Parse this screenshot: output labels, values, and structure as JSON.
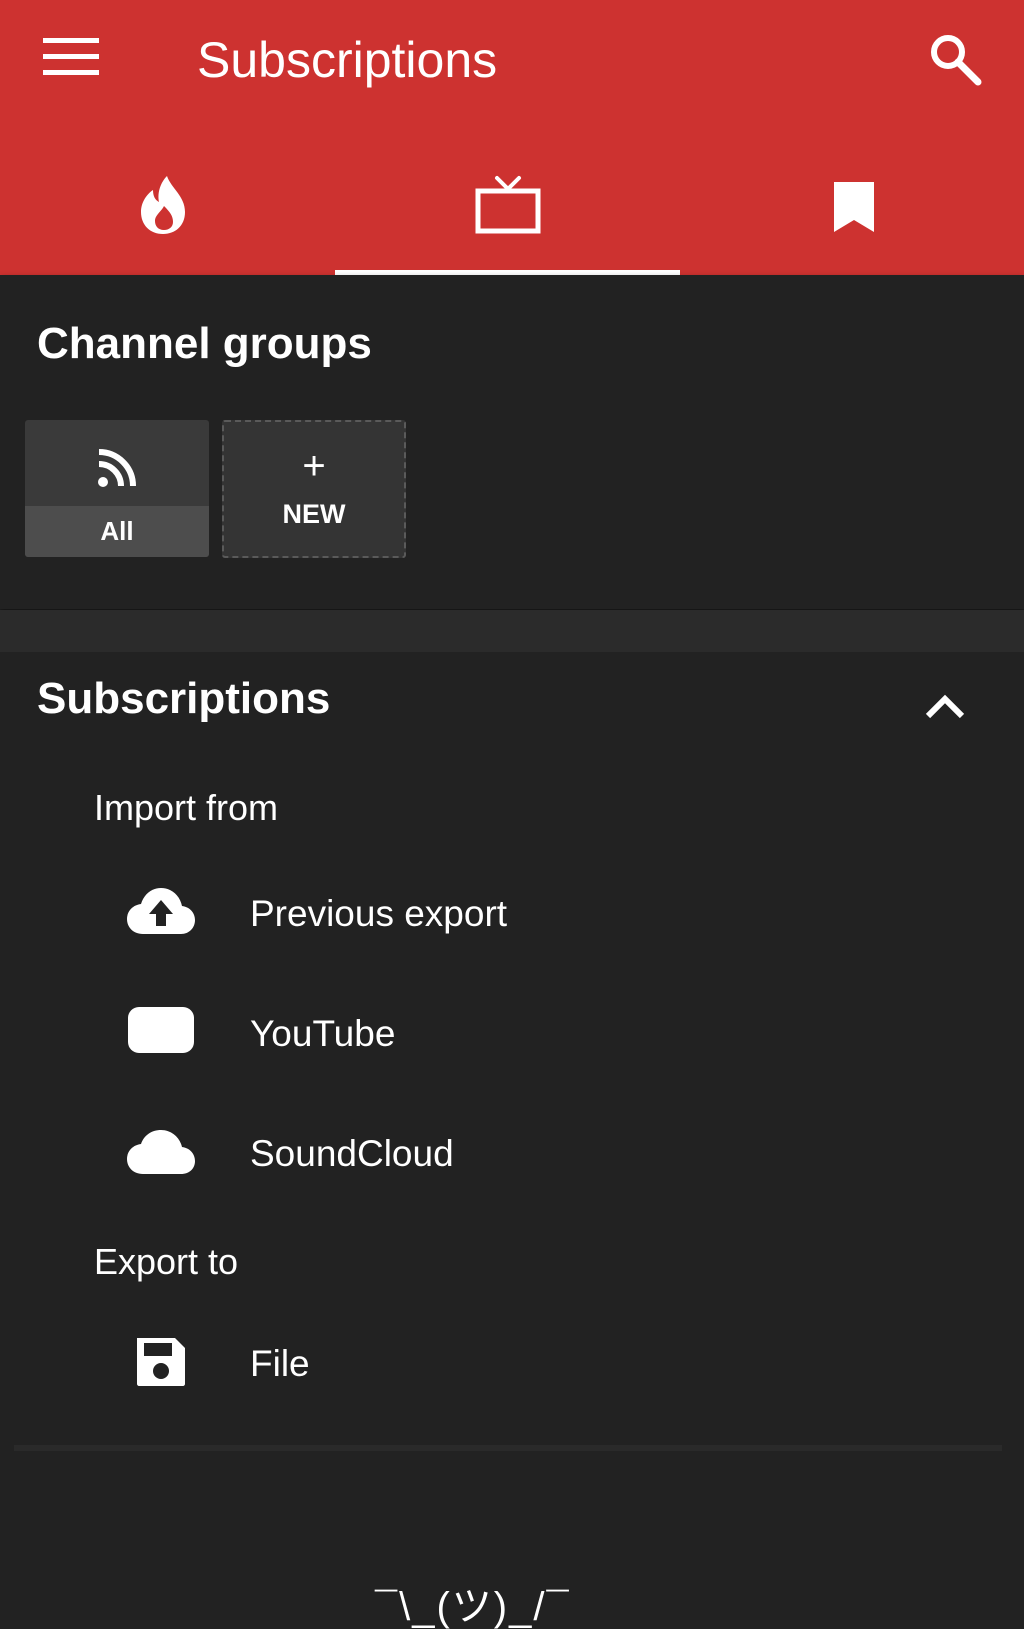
{
  "appbar": {
    "title": "Subscriptions",
    "color": "#cd3230",
    "menu_icon": "menu-icon",
    "search_icon": "search-icon"
  },
  "tabs": [
    {
      "name": "trending",
      "icon": "fire-icon",
      "selected": false
    },
    {
      "name": "subscriptions",
      "icon": "tv-icon",
      "selected": true
    },
    {
      "name": "bookmarks",
      "icon": "bookmark-icon",
      "selected": false
    }
  ],
  "channel_groups": {
    "title": "Channel groups",
    "groups": [
      {
        "label": "All",
        "icon": "rss-icon"
      }
    ],
    "new_button": {
      "symbol": "+",
      "label": "NEW"
    }
  },
  "subscriptions": {
    "title": "Subscriptions",
    "collapse_icon": "chevron-up-icon",
    "import_heading": "Import from",
    "import_items": [
      {
        "label": "Previous export",
        "icon": "cloud-upload-icon"
      },
      {
        "label": "YouTube",
        "icon": "youtube-icon"
      },
      {
        "label": "SoundCloud",
        "icon": "cloud-icon"
      }
    ],
    "export_heading": "Export to",
    "export_items": [
      {
        "label": "File",
        "icon": "save-icon"
      }
    ]
  },
  "bottom_partial_text": "¯\\_(ツ)_/¯"
}
